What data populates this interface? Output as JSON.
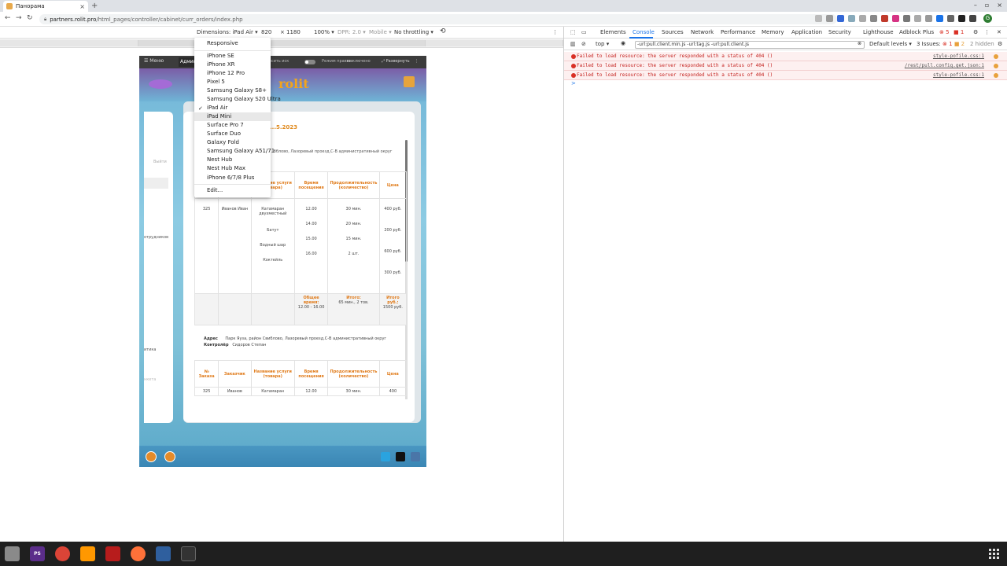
{
  "browser": {
    "tab_title": "Панорама",
    "new_tab": "+",
    "url_host": "partners.rolit.pro",
    "url_path": "/html_pages/controller/cabinet/curr_orders/index.php",
    "profile_initial": "G",
    "window_controls": [
      "–",
      "▫",
      "×"
    ]
  },
  "device_toolbar": {
    "dimensions_label": "Dimensions: iPad Air",
    "width": "820",
    "height": "1180",
    "zoom": "100%",
    "dpr": "DPR: 2.0",
    "mobile": "Mobile",
    "throttle": "No throttling"
  },
  "device_menu": {
    "items": [
      "Responsive",
      "iPhone SE",
      "iPhone XR",
      "iPhone 12 Pro",
      "Pixel 5",
      "Samsung Galaxy S8+",
      "Samsung Galaxy S20 Ultra",
      "iPad Air",
      "iPad Mini",
      "Surface Pro 7",
      "Surface Duo",
      "Galaxy Fold",
      "Samsung Galaxy A51/71",
      "Nest Hub",
      "Nest Hub Max",
      "iPhone 6/7/8 Plus",
      "Edit..."
    ],
    "checked": "iPad Air",
    "hovered": "iPad Mini"
  },
  "site": {
    "menu": "Меню",
    "admin": "Админ",
    "topbar_text1": "...осить иск",
    "topbar_text2": "Режим правки",
    "topbar_text3": "выключено",
    "expand": "Развернуть",
    "logo": "rolit",
    "left_labels": [
      "Выйти",
      "отрудников",
      "итика",
      "нкета"
    ],
    "date": "...5.2023",
    "address1": "...бблово, Лазоревый проезд,С-В административный округ",
    "headers": [
      "№ Заказа",
      "Заказчик",
      "Название услуги (товара)",
      "Время посещения",
      "Продолжительность (количество)",
      "Цена"
    ],
    "row": {
      "order": "325",
      "customer": "Иванов Иван",
      "services": [
        "Катамаран двухместный",
        "Батут",
        "Водный шар",
        "Коктейль"
      ],
      "times": [
        "12.00",
        "14.00",
        "15.00",
        "16.00"
      ],
      "durations": [
        "30 мин.",
        "20 мин.",
        "15 мин.",
        "2 шт."
      ],
      "prices": [
        "400 руб.",
        "200 руб.",
        "600 руб.",
        "300 руб."
      ]
    },
    "totals": {
      "time_label": "Общее время:",
      "time_value": "12.00 - 16.00",
      "duration_label": "Итого:",
      "duration_value": "65 мин., 2 тов.",
      "price_label": "Итого руб.:",
      "price_value": "1500 руб."
    },
    "address_label": "Адрес",
    "controller_label": "Контролёр",
    "address2": "Парк Яуза, район Свиблово, Лазоревый проезд,С-В административный округ",
    "controller": "Сидоров Степан",
    "row2": {
      "order": "325",
      "customer": "Иванов",
      "service": "Катамаран",
      "time": "12.00",
      "duration": "30 мин.",
      "price": "400"
    }
  },
  "devtools": {
    "tabs": [
      "Elements",
      "Console",
      "Sources",
      "Network",
      "Performance",
      "Memory",
      "Application",
      "Security",
      "Lighthouse",
      "Adblock Plus"
    ],
    "active_tab": "Console",
    "err_count": "5",
    "warn_count": "1",
    "context": "top",
    "filter": "-url:pull.client.min.js -url:tag.js -url:pull.client.js",
    "levels": "Default levels",
    "issues": "3 Issues:",
    "issues_err": "1",
    "issues_warn": "2",
    "hidden": "2 hidden",
    "errors": [
      {
        "msg": "Failed to load resource: the server responded with a status of 404 ()",
        "src": "style-pofile.css:1"
      },
      {
        "msg": "Failed to load resource: the server responded with a status of 404 ()",
        "src": "/rest/pull.config.get.json:1"
      },
      {
        "msg": "Failed to load resource: the server responded with a status of 404 ()",
        "src": "style-pofile.css:1"
      }
    ],
    "prompt": ">"
  },
  "taskbar": {
    "apps": [
      "files",
      "PS",
      "chrome",
      "sublime",
      "filezilla",
      "firefox",
      "virtualbox",
      "terminal"
    ]
  },
  "colors": {
    "accent_orange": "#e07b1a",
    "devtools_blue": "#1a73e8",
    "error_red": "#d93025"
  }
}
